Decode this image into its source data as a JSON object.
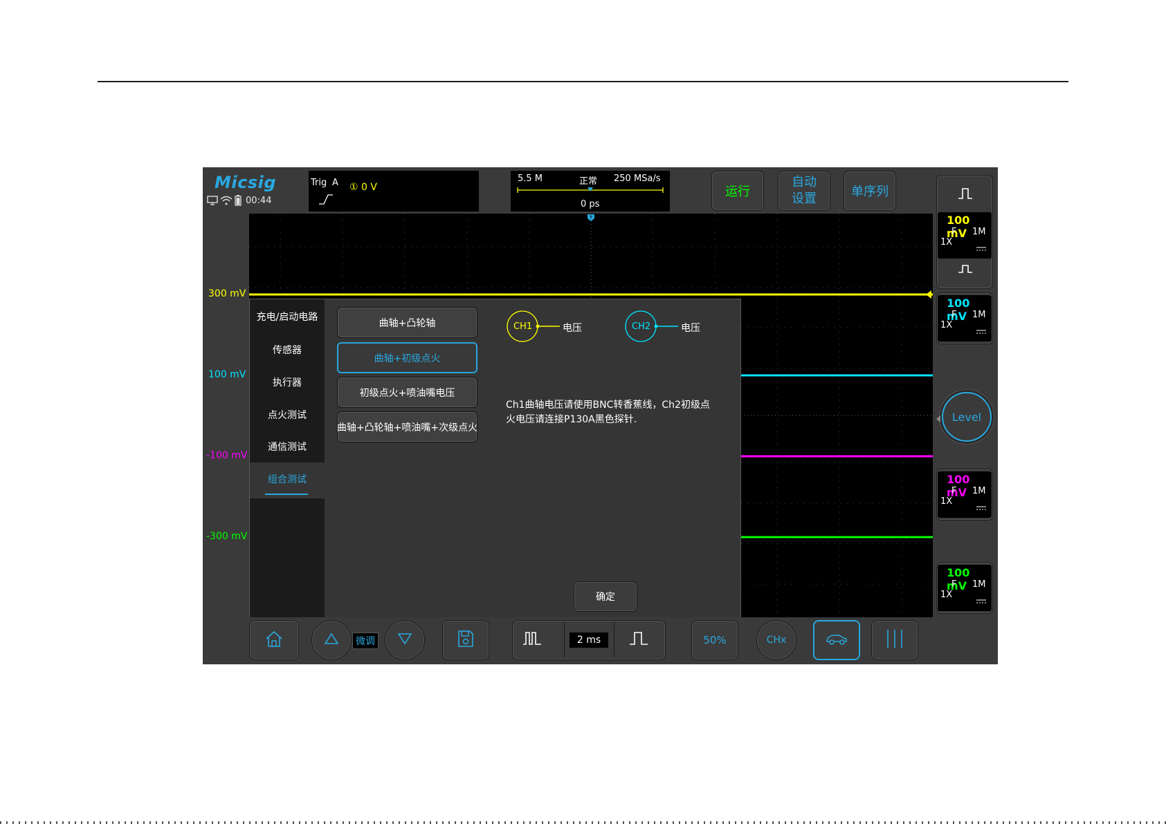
{
  "brand": {
    "logo": "Micsig",
    "clock": "00:44"
  },
  "trigger": {
    "title": "Trig",
    "source": "A",
    "level": "① 0 V"
  },
  "acquisition": {
    "depth": "5.5 M",
    "mode": "正常",
    "rate": "250 MSa/s",
    "position": "0 ps"
  },
  "top_buttons": {
    "run": "运行",
    "auto_line1": "自动",
    "auto_line2": "设置",
    "single": "单序列"
  },
  "scale_labels": {
    "ch1": "300 mV",
    "ch2": "100 mV",
    "ch3": "-100 mV",
    "ch4": "-300 mV"
  },
  "channels": [
    {
      "volts": "100 mV",
      "coupling": "F",
      "impedance": "1M",
      "probe": "1X",
      "color": "#ffff00"
    },
    {
      "volts": "100 mV",
      "coupling": "F",
      "impedance": "1M",
      "probe": "1X",
      "color": "#00e5ff"
    },
    {
      "volts": "100 mV",
      "coupling": "F",
      "impedance": "1M",
      "probe": "1X",
      "color": "#ff00ff"
    },
    {
      "volts": "100 mV",
      "coupling": "F",
      "impedance": "1M",
      "probe": "1X",
      "color": "#00ff00"
    }
  ],
  "level_knob": "Level",
  "dialog": {
    "categories": [
      "充电/启动电路",
      "传感器",
      "执行器",
      "点火测试",
      "通信测试",
      "组合测试"
    ],
    "active_category": "组合测试",
    "options": [
      "曲轴+凸轮轴",
      "曲轴+初级点火",
      "初级点火+喷油嘴电压",
      "曲轴+凸轮轴+喷油嘴+次级点火"
    ],
    "active_option": "曲轴+初级点火",
    "ch1": {
      "label": "CH1",
      "measure": "电压"
    },
    "ch2": {
      "label": "CH2",
      "measure": "电压"
    },
    "instruction_line1": "Ch1曲轴电压请使用BNC转香蕉线，Ch2初级点",
    "instruction_line2": "火电压请连接P130A黑色探针.",
    "confirm": "确定"
  },
  "bottom_bar": {
    "fine_tune": "微调",
    "timebase": "2 ms",
    "fifty_percent": "50%",
    "ch_select": "CHx"
  },
  "colors": {
    "accent": "#29a8e0",
    "ch1": "#ffff00",
    "ch2": "#00e5ff",
    "ch3": "#ff00ff",
    "ch4": "#00ff00"
  }
}
